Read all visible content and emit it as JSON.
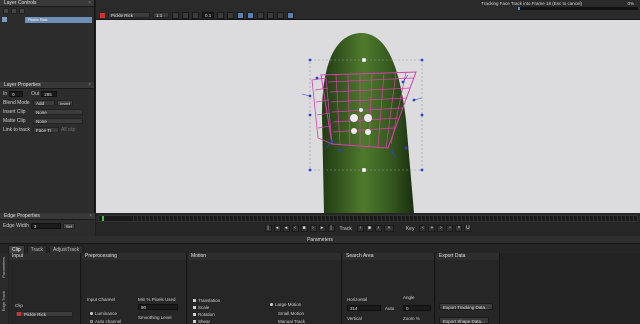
{
  "layer_controls": {
    "title": "Layer Controls",
    "layer_name": "Pickle Rick"
  },
  "layer_properties": {
    "title": "Layer Properties",
    "in_label": "In",
    "in_value": "0",
    "out_label": "Out",
    "out_value": "285",
    "blend_mode_label": "Blend Mode",
    "blend_mode_value": "Add",
    "invert_label": "Invert",
    "insert_clip_label": "Insert Clip",
    "insert_clip_value": "None",
    "matte_clip_label": "Matte Clip",
    "matte_clip_value": "None",
    "link_label": "Link to track",
    "link_value": "Face Tr",
    "link_extra": "All clip"
  },
  "edge_properties": {
    "title": "Edge Properties",
    "edge_width_label": "Edge Width",
    "edge_width_value": "3",
    "set_label": "Set"
  },
  "viewer": {
    "clip_name": "Pickle Rick",
    "zoom": "1:1",
    "value": "0.1",
    "status": "Tracking Face Track into Frame 18 (Esc to cancel)",
    "percent": "0%",
    "progress": 0.02
  },
  "timeline": {
    "track_label": "Track",
    "key_label": "Key"
  },
  "parameters": {
    "title": "Parameters",
    "tabs": [
      "Clip",
      "Track",
      "AdjustTrack"
    ],
    "side_tabs": [
      "Parameters",
      "Edge Track"
    ],
    "input": {
      "title": "Input",
      "clip_label": "Clip",
      "clip_value": "Pickle Rick"
    },
    "preprocessing": {
      "title": "Preprocessing",
      "input_channel_label": "Input Channel",
      "luminance_label": "Luminance",
      "auto_channel_label": "Auto channel",
      "min_pixels_label": "Min % Pixels Used",
      "min_pixels_value": "90",
      "smoothing_label": "Smoothing Level"
    },
    "motion": {
      "title": "Motion",
      "options": [
        "Translation",
        "Scale",
        "Rotation",
        "Shear"
      ],
      "large_motion": "Large Motion",
      "small_motion": "Small Motion",
      "manual_track": "Manual Track"
    },
    "search_area": {
      "title": "Search Area",
      "horizontal_label": "Horizontal",
      "horizontal_value": "314",
      "auto_label": "Auto",
      "vertical_label": "Vertical",
      "angle_label": "Angle",
      "angle_value": "0",
      "zoom_label": "Zoom %"
    },
    "export": {
      "title": "Export Data",
      "tracking_button": "Export Tracking Data...",
      "shape_button": "Export Shape Data..."
    }
  }
}
